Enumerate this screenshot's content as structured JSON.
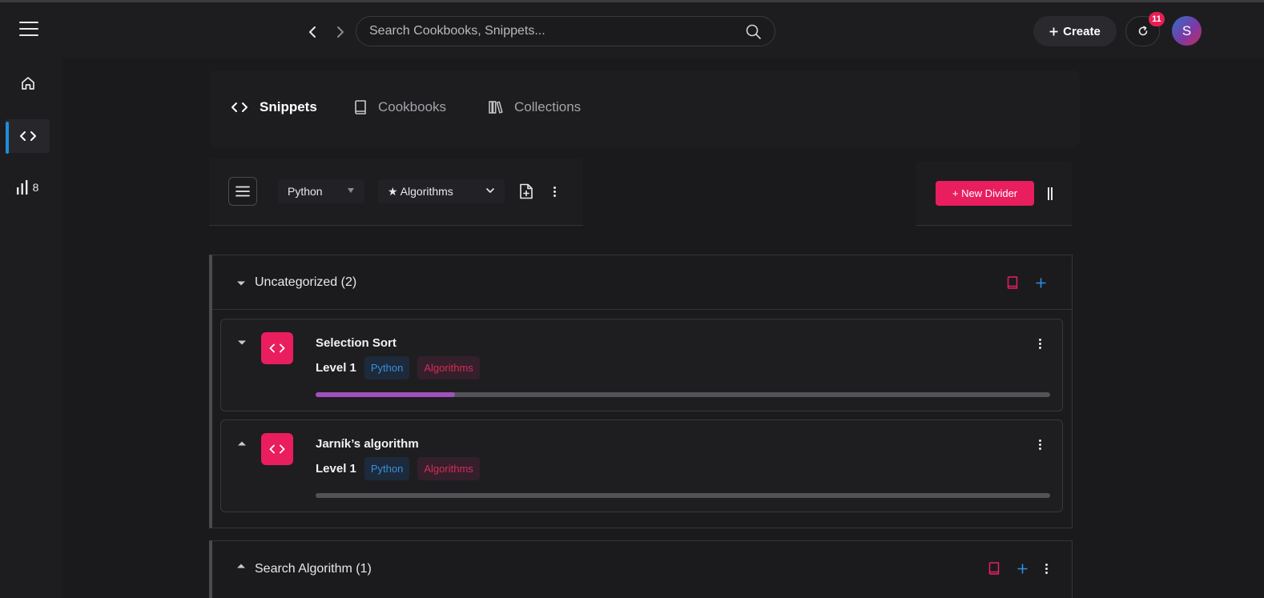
{
  "header": {
    "search_placeholder": "Search Cookbooks, Snippets...",
    "create_label": "Create",
    "notification_count": "11",
    "avatar_initial": "S"
  },
  "sidebar": {
    "items": [
      {
        "name": "home",
        "icon": "home-icon"
      },
      {
        "name": "snippets",
        "icon": "code-icon",
        "active": true
      },
      {
        "name": "stats",
        "icon": "bar-chart-icon",
        "count": "8"
      }
    ]
  },
  "tabs": [
    {
      "label": "Snippets",
      "icon": "code-icon",
      "active": true
    },
    {
      "label": "Cookbooks",
      "icon": "book-icon",
      "active": false
    },
    {
      "label": "Collections",
      "icon": "library-icon",
      "active": false
    }
  ],
  "filters": {
    "language": "Python",
    "category": "★ Algorithms"
  },
  "actions": {
    "new_divider_label": "+ New Divider"
  },
  "groups": [
    {
      "title": "Uncategorized (2)",
      "expanded": true,
      "snippets": [
        {
          "title": "Selection Sort",
          "level": "Level 1",
          "language": "Python",
          "category": "Algorithms",
          "progress": 0.19,
          "expanded": false
        },
        {
          "title": "Jarník’s algorithm",
          "level": "Level 1",
          "language": "Python",
          "category": "Algorithms",
          "progress": 0,
          "expanded": true
        }
      ]
    },
    {
      "title": "Search Algorithm (1)",
      "expanded": false
    }
  ],
  "colors": {
    "accent": "#e91e5f",
    "active_indicator": "#1e8fd6",
    "progress_fill": "#a24fbf",
    "background": "#1a1a1d"
  }
}
